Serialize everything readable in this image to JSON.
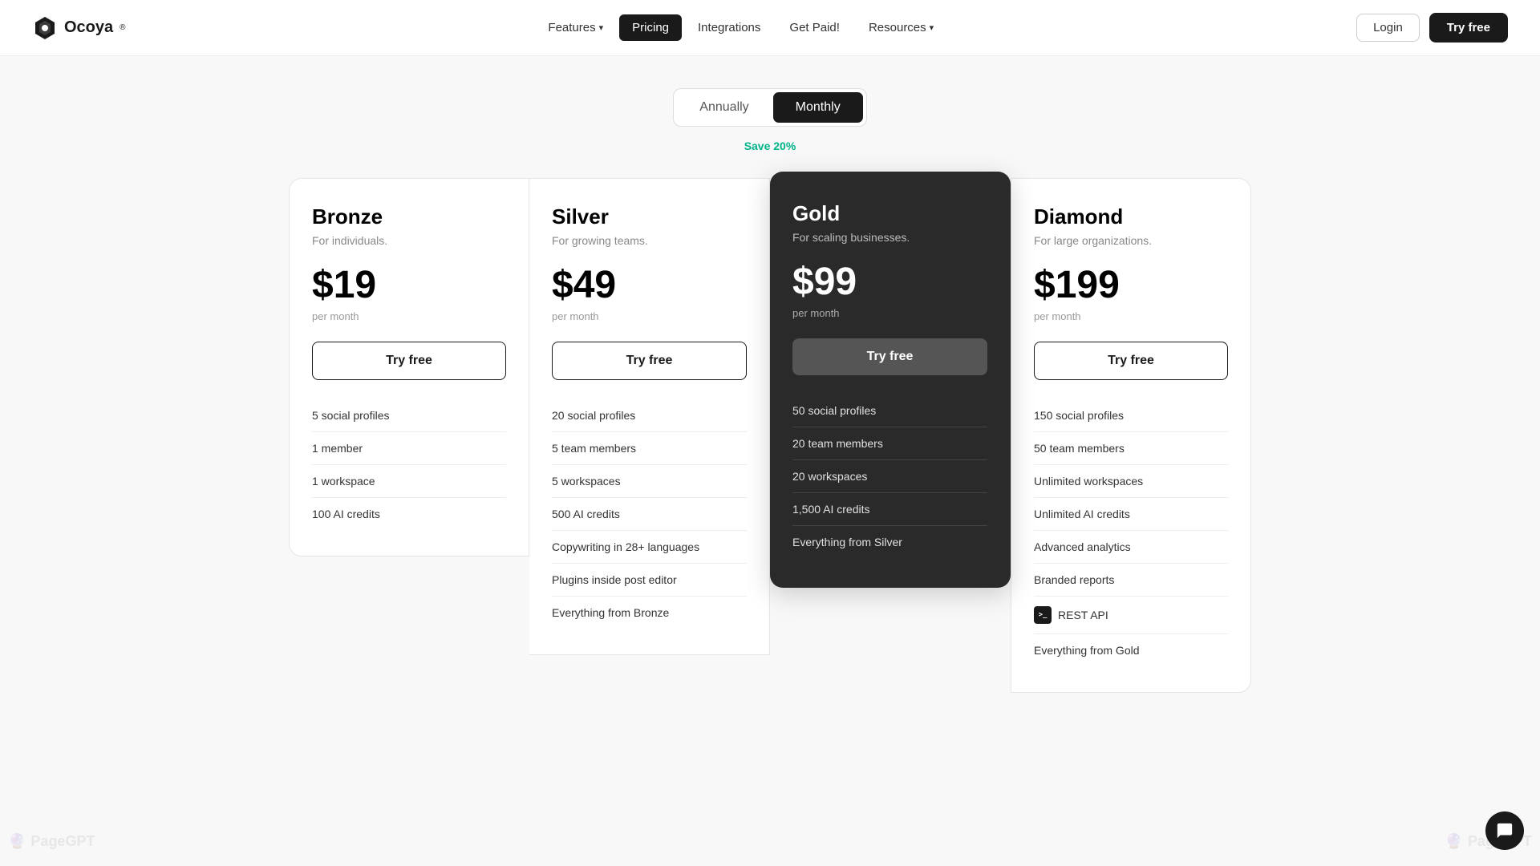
{
  "brand": {
    "name": "Ocoya",
    "trademark": "®",
    "logo_shape": "hexagon"
  },
  "nav": {
    "items": [
      {
        "label": "Features",
        "has_dropdown": true,
        "active": false
      },
      {
        "label": "Pricing",
        "has_dropdown": false,
        "active": true
      },
      {
        "label": "Integrations",
        "has_dropdown": false,
        "active": false
      },
      {
        "label": "Get Paid!",
        "has_dropdown": false,
        "active": false
      },
      {
        "label": "Resources",
        "has_dropdown": true,
        "active": false
      }
    ],
    "login_label": "Login",
    "try_free_label": "Try free"
  },
  "billing": {
    "annually_label": "Annually",
    "monthly_label": "Monthly",
    "active": "monthly",
    "save_label": "Save 20%"
  },
  "plans": [
    {
      "id": "bronze",
      "name": "Bronze",
      "tagline": "For individuals.",
      "price": "$19",
      "period": "per month",
      "cta": "Try free",
      "featured": false,
      "features": [
        "5 social profiles",
        "1 member",
        "1 workspace",
        "100 AI credits"
      ]
    },
    {
      "id": "silver",
      "name": "Silver",
      "tagline": "For growing teams.",
      "price": "$49",
      "period": "per month",
      "cta": "Try free",
      "featured": false,
      "features": [
        "20 social profiles",
        "5 team members",
        "5 workspaces",
        "500 AI credits",
        "Copywriting in 28+ languages",
        "Plugins inside post editor",
        "Everything from Bronze"
      ]
    },
    {
      "id": "gold",
      "name": "Gold",
      "tagline": "For scaling businesses.",
      "price": "$99",
      "period": "per month",
      "cta": "Try free",
      "featured": true,
      "features": [
        "50 social profiles",
        "20 team members",
        "20 workspaces",
        "1,500 AI credits",
        "Everything from Silver"
      ]
    },
    {
      "id": "diamond",
      "name": "Diamond",
      "tagline": "For large organizations.",
      "price": "$199",
      "period": "per month",
      "cta": "Try free",
      "featured": false,
      "features": [
        "150 social profiles",
        "50 team members",
        "Unlimited workspaces",
        "Unlimited AI credits",
        "Advanced analytics",
        "Branded reports",
        "REST API",
        "Everything from Gold"
      ],
      "rest_api_index": 6
    }
  ],
  "watermark": "PageGPT",
  "chat_icon": "💬"
}
